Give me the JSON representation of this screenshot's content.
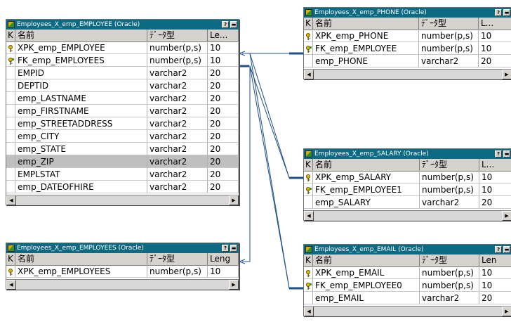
{
  "tables": {
    "employee": {
      "title": "Employees_X_emp_EMPLOYEE (Oracle)",
      "headers": [
        "K",
        "名前",
        "ﾃﾞｰﾀ型",
        "Le..."
      ],
      "rows": [
        {
          "key": "pk",
          "name": "XPK_emp_EMPLOYEE",
          "type": "number(p,s)",
          "len": "10"
        },
        {
          "key": "fk",
          "name": "FK_emp_EMPLOYEES",
          "type": "number(p,s)",
          "len": "10"
        },
        {
          "key": "",
          "name": "EMPID",
          "type": "varchar2",
          "len": "20"
        },
        {
          "key": "",
          "name": "DEPTID",
          "type": "varchar2",
          "len": "20"
        },
        {
          "key": "",
          "name": "emp_LASTNAME",
          "type": "varchar2",
          "len": "20"
        },
        {
          "key": "",
          "name": "emp_FIRSTNAME",
          "type": "varchar2",
          "len": "20"
        },
        {
          "key": "",
          "name": "emp_STREETADDRESS",
          "type": "varchar2",
          "len": "20"
        },
        {
          "key": "",
          "name": "emp_CITY",
          "type": "varchar2",
          "len": "20"
        },
        {
          "key": "",
          "name": "emp_STATE",
          "type": "varchar2",
          "len": "20"
        },
        {
          "key": "",
          "name": "emp_ZIP",
          "type": "varchar2",
          "len": "20",
          "selected": true
        },
        {
          "key": "",
          "name": "EMPLSTAT",
          "type": "varchar2",
          "len": "20"
        },
        {
          "key": "",
          "name": "emp_DATEOFHIRE",
          "type": "varchar2",
          "len": "20"
        }
      ]
    },
    "employees": {
      "title": "Employees_X_emp_EMPLOYEES (Oracle)",
      "headers": [
        "K",
        "名前",
        "ﾃﾞｰﾀ型",
        "Leng"
      ],
      "rows": [
        {
          "key": "pk",
          "name": "XPK_emp_EMPLOYEES",
          "type": "number(p,s)",
          "len": "10"
        }
      ]
    },
    "phone": {
      "title": "Employees_X_emp_PHONE (Oracle)",
      "headers": [
        "K",
        "名前",
        "ﾃﾞｰﾀ型",
        "L..."
      ],
      "rows": [
        {
          "key": "pk",
          "name": "XPK_emp_PHONE",
          "type": "number(p,s)",
          "len": "10"
        },
        {
          "key": "fk",
          "name": "FK_emp_EMPLOYEE",
          "type": "number(p,s)",
          "len": "10"
        },
        {
          "key": "",
          "name": "emp_PHONE",
          "type": "varchar2",
          "len": "20"
        }
      ]
    },
    "salary": {
      "title": "Employees_X_emp_SALARY (Oracle)",
      "headers": [
        "K",
        "名前",
        "ﾃﾞｰﾀ型",
        "L..."
      ],
      "rows": [
        {
          "key": "pk",
          "name": "XPK_emp_SALARY",
          "type": "number(p,s)",
          "len": "10"
        },
        {
          "key": "fk",
          "name": "FK_emp_EMPLOYEE1",
          "type": "number(p,s)",
          "len": "10"
        },
        {
          "key": "",
          "name": "emp_SALARY",
          "type": "varchar2",
          "len": "20"
        }
      ]
    },
    "email": {
      "title": "Employees_X_emp_EMAIL (Oracle)",
      "headers": [
        "K",
        "名前",
        "ﾃﾞｰﾀ型",
        "Len"
      ],
      "rows": [
        {
          "key": "pk",
          "name": "XPK_emp_EMAIL",
          "type": "number(p,s)",
          "len": "10"
        },
        {
          "key": "fk",
          "name": "FK_emp_EMPLOYEE0",
          "type": "number(p,s)",
          "len": "10"
        },
        {
          "key": "",
          "name": "emp_EMAIL",
          "type": "varchar2",
          "len": "20"
        }
      ]
    }
  },
  "colors": {
    "title_bar": "#0c6a82",
    "link_line": "#1f4f8a",
    "selected_row": "#c0c0c0",
    "header_bg": "#d6d3ce"
  },
  "icons": {
    "primary_key": "pk-key-icon",
    "foreign_key": "fk-key-icon",
    "table": "table-icon",
    "help": "help-icon",
    "minimize": "minimize-icon",
    "scroll_left": "scroll-left-arrow",
    "scroll_right": "scroll-right-arrow"
  },
  "window_buttons": {
    "help_label": "?",
    "minimize_label": "▬"
  }
}
